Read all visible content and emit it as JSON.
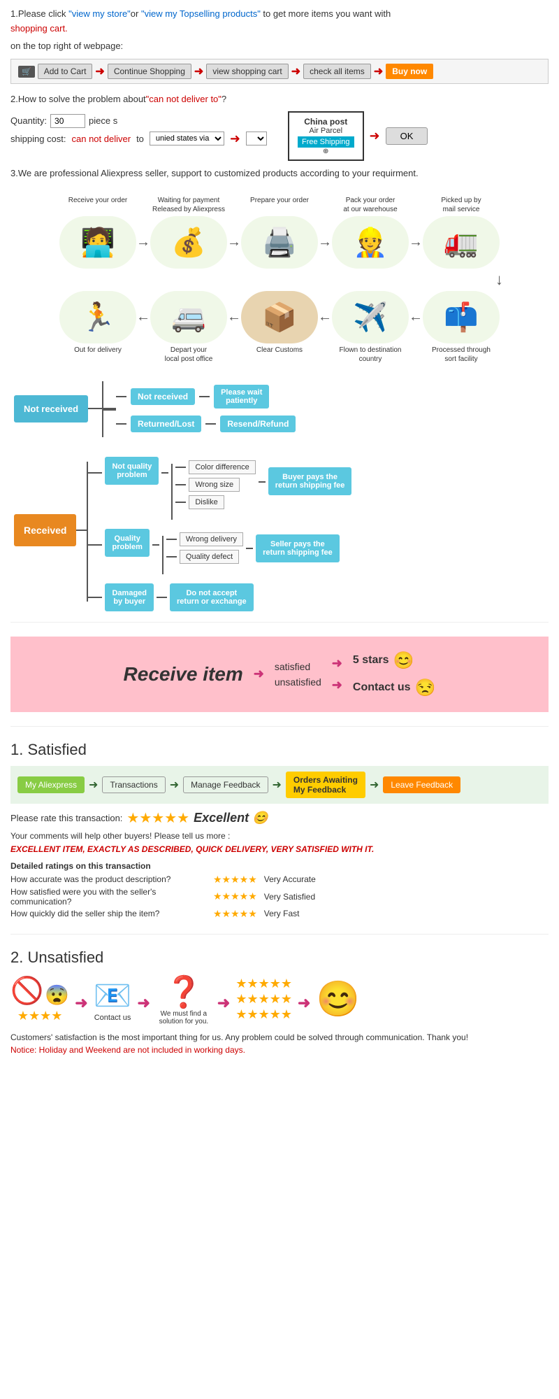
{
  "section1": {
    "text1": "1.Please click ",
    "link1": "\"view my store\"",
    "text2": "or ",
    "link2": "\"view my Topselling products\"",
    "text3": " to get more items you want with",
    "shopping_cart": "shopping cart.",
    "text4": "on the top right of webpage:",
    "buttons": {
      "add_to_cart": "Add to Cart",
      "continue_shopping": "Continue Shopping",
      "view_cart": "view shopping cart",
      "check_items": "check all items",
      "buy_now": "Buy now"
    }
  },
  "section2": {
    "title": "2.How to solve the problem about",
    "problem": "\"can not deliver to\"",
    "question": "?",
    "quantity_label": "Quantity:",
    "quantity_value": "30",
    "piece_label": "piece s",
    "shipping_label": "shipping cost:",
    "cannot_deliver": "can not deliver",
    "to_text": " to ",
    "united_states": "unied states via",
    "china_post_line1": "China post",
    "china_post_line2": "Air Parcel",
    "free_shipping": "Free Shipping",
    "ok_btn": "OK"
  },
  "section3": {
    "text": "3.We are professional Aliexpress seller, support to customized products according to your requirment."
  },
  "order_flow": {
    "row1": [
      {
        "label": "Receive your order",
        "icon": "🧑‍💻"
      },
      {
        "label": "Waiting for payment\nReleased by Aliexpress",
        "icon": "💰"
      },
      {
        "label": "Prepare your order",
        "icon": "🖨️"
      },
      {
        "label": "Pack your order\nat our warehouse",
        "icon": "👷"
      },
      {
        "label": "Picked up by\nmail service",
        "icon": "🚛"
      }
    ],
    "row2": [
      {
        "label": "Out for delivery",
        "icon": "🏃"
      },
      {
        "label": "Depart your\nlocal post office",
        "icon": "🚐"
      },
      {
        "label": "Clear Customs",
        "icon": "📦"
      },
      {
        "label": "Flown to destination\ncountry",
        "icon": "✈️"
      },
      {
        "label": "Processed through\nsort facility",
        "icon": "📫"
      }
    ]
  },
  "not_received_tree": {
    "root": "Not received",
    "branches": [
      {
        "label": "Not received",
        "outcome": "Please wait\npatiently"
      },
      {
        "label": "Returned/Lost",
        "outcome": "Resend/Refund"
      }
    ]
  },
  "received_tree": {
    "root": "Received",
    "branches": [
      {
        "label": "Not quality\nproblem",
        "sub": [
          "Color difference",
          "Wrong size",
          "Dislike"
        ],
        "outcome": "Buyer pays the\nreturn shipping fee"
      },
      {
        "label": "Quality\nproblem",
        "sub": [
          "Wrong delivery",
          "Quality defect"
        ],
        "outcome": "Seller pays the\nreturn shipping fee"
      },
      {
        "label": "Damaged\nby buyer",
        "outcome": "Do not accept\nreturn or exchange"
      }
    ]
  },
  "receive_item": {
    "title": "Receive item",
    "satisfied_label": "satisfied",
    "unsatisfied_label": "unsatisfied",
    "five_stars": "5 stars",
    "contact_us": "Contact us",
    "emoji_happy": "😊",
    "emoji_meh": "😒"
  },
  "satisfied": {
    "title": "1. Satisfied",
    "flow": [
      "My Aliexpress",
      "Transactions",
      "Manage Feedback",
      "Orders Awaiting\nMy Feedback",
      "Leave Feedback"
    ],
    "rate_text": "Please rate this transaction:",
    "stars": "★★★★★",
    "excellent": "Excellent 😊",
    "comments": "Your comments will help other buyers! Please tell us more :",
    "review": "EXCELLENT ITEM, EXACTLY AS DESCRIBED, QUICK DELIVERY, VERY SATISFIED WITH IT.",
    "detailed_label": "Detailed ratings on this transaction",
    "ratings": [
      {
        "question": "How accurate was the product description?",
        "stars": "★★★★★",
        "result": "Very Accurate"
      },
      {
        "question": "How satisfied were you with the seller's communication?",
        "stars": "★★★★★",
        "result": "Very Satisfied"
      },
      {
        "question": "How quickly did the seller ship the item?",
        "stars": "★★★★★",
        "result": "Very Fast"
      }
    ]
  },
  "unsatisfied": {
    "title": "2. Unsatisfied",
    "steps": [
      {
        "icon": "🚫",
        "sub_icon": "😨",
        "label": "★★★★"
      },
      {
        "icon": "📧",
        "label": "Contact us"
      },
      {
        "icon": "❓",
        "label": "We must find\na solution for\nyou."
      },
      {
        "icon": "⭐⭐⭐⭐⭐\n⭐⭐⭐⭐⭐\n⭐⭐⭐⭐⭐",
        "label": ""
      },
      {
        "icon": "😊",
        "label": ""
      }
    ],
    "notice_black": "Customers' satisfaction is the most important thing for us. Any problem could be solved through communication. Thank you!",
    "notice_red": "Notice: Holiday and Weekend are not included in working days."
  }
}
